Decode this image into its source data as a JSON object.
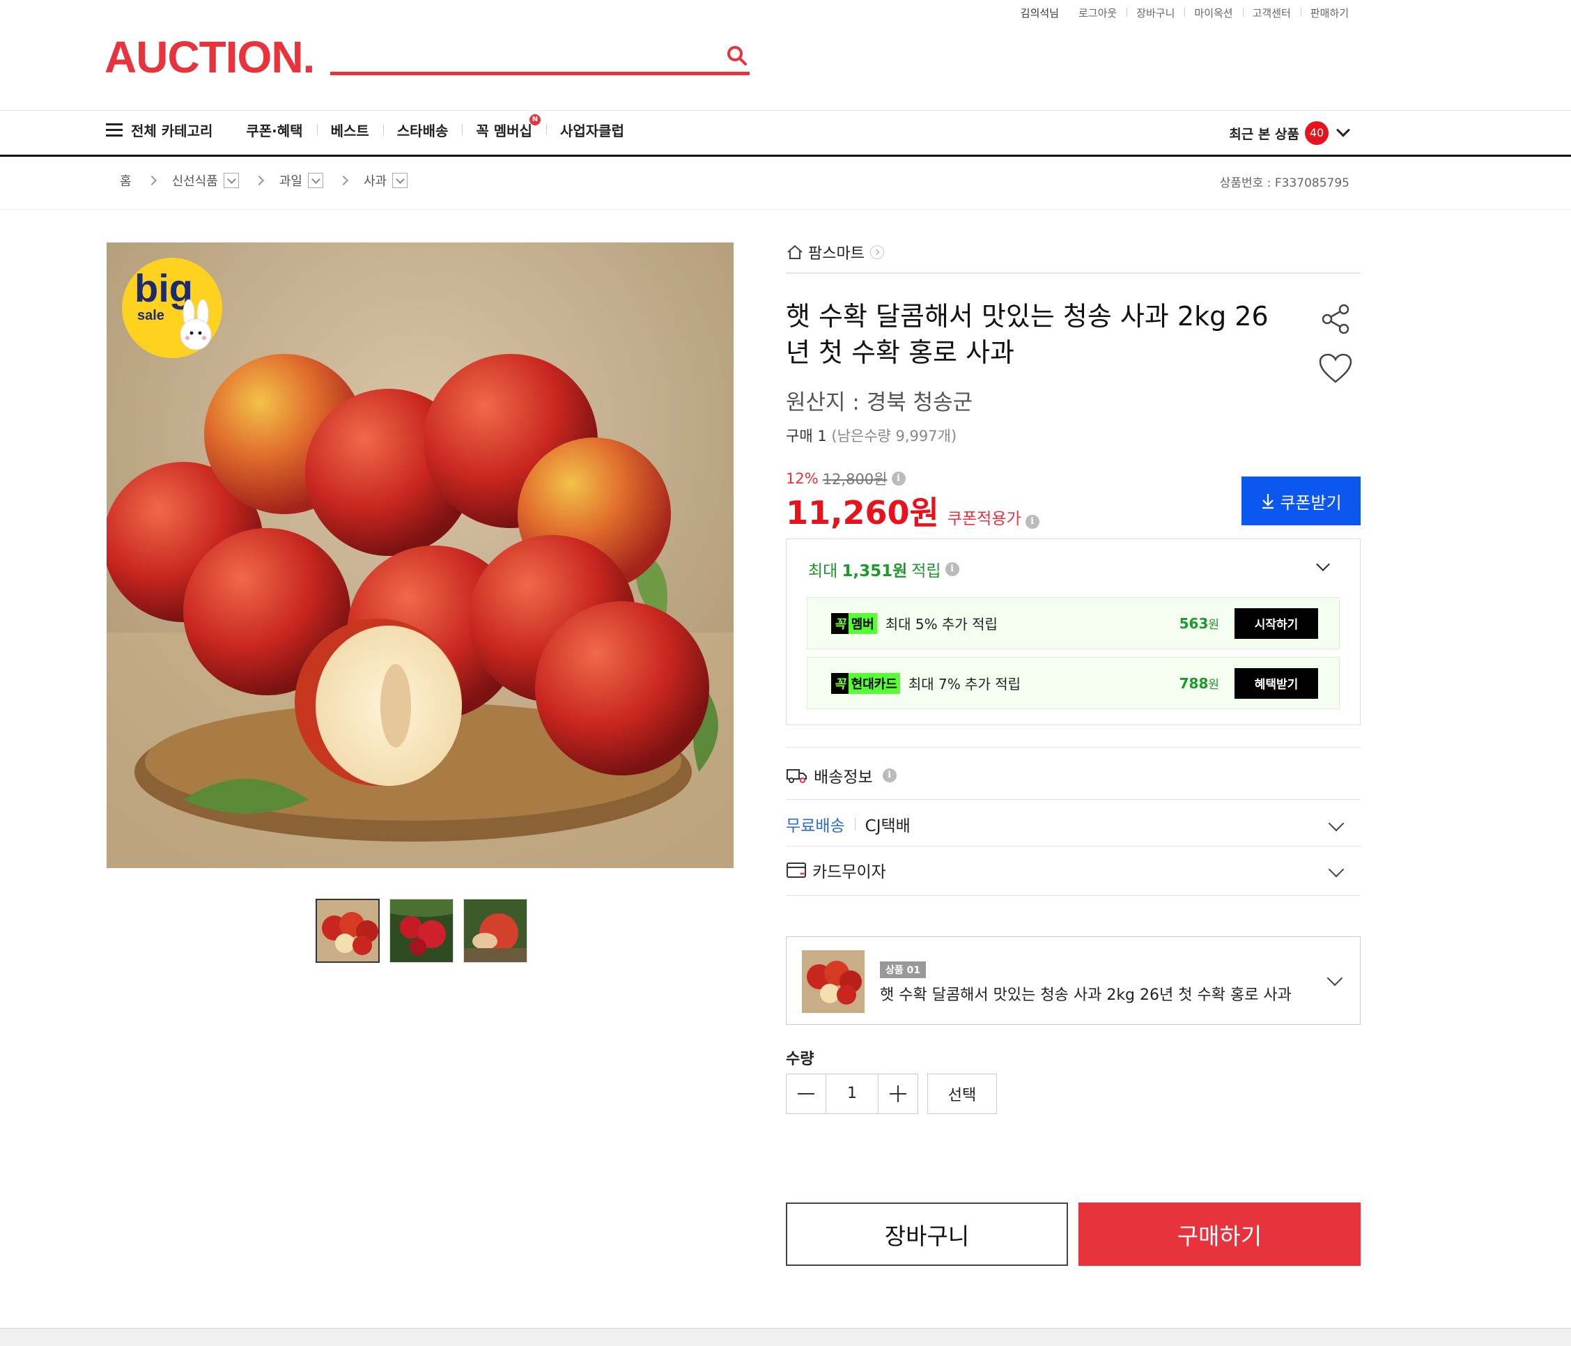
{
  "util_links": {
    "user": "김의석님",
    "logout": "로그아웃",
    "cart": "장바구니",
    "my": "마이옥션",
    "cs": "고객센터",
    "sell": "판매하기"
  },
  "logo": "AUCTION",
  "search": {
    "placeholder": ""
  },
  "nav": {
    "all_category": "전체 카테고리",
    "coupon": "쿠폰·혜택",
    "best": "베스트",
    "star": "스타배송",
    "membership": "꼭 멤버십",
    "membership_badge": "N",
    "business": "사업자클럽",
    "recent_label": "최근 본 상품",
    "recent_count": "40"
  },
  "breadcrumb": {
    "home": "홈",
    "c1": "신선식품",
    "c2": "과일",
    "c3": "사과"
  },
  "product_no": "상품번호 : F337085795",
  "image": {
    "badge_big": "big",
    "badge_sale": "sale"
  },
  "seller": "팜스마트",
  "title": "햇 수확 달콤해서 맛있는 청송 사과 2kg 26년 첫 수확 홍로 사과",
  "origin": "원산지 : 경북 청송군",
  "purchase": {
    "label": "구매 1",
    "remaining": "(남은수량 9,997개)"
  },
  "discount": {
    "percent": "12%",
    "original": "12,800원"
  },
  "price": {
    "value": "11,260원",
    "label": "쿠폰적용가"
  },
  "coupon_button": "쿠폰받기",
  "points": {
    "prefix": "최대",
    "amount": "1,351원",
    "suffix": "적립",
    "rows": [
      {
        "tag_k": "꼭",
        "tag_t": "멤버",
        "text": "최대 5% 추가 적립",
        "amount": "563",
        "unit": "원",
        "button": "시작하기"
      },
      {
        "tag_k": "꼭",
        "tag_t": "현대카드",
        "text": "최대 7% 추가 적립",
        "amount": "788",
        "unit": "원",
        "button": "혜택받기"
      }
    ]
  },
  "shipping": {
    "title": "배송정보",
    "free": "무료배송",
    "carrier": "CJ택배",
    "card": "카드무이자"
  },
  "option": {
    "badge": "상품 01",
    "name": "햇 수확 달콤해서 맛있는 청송 사과 2kg 26년 첫 수확 홍로 사과"
  },
  "quantity": {
    "label": "수량",
    "value": "1",
    "select": "선택"
  },
  "actions": {
    "cart": "장바구니",
    "buy": "구매하기"
  },
  "colors": {
    "brand": "#e8323c",
    "coupon": "#0b57f0",
    "points": "#1a9b2b"
  }
}
